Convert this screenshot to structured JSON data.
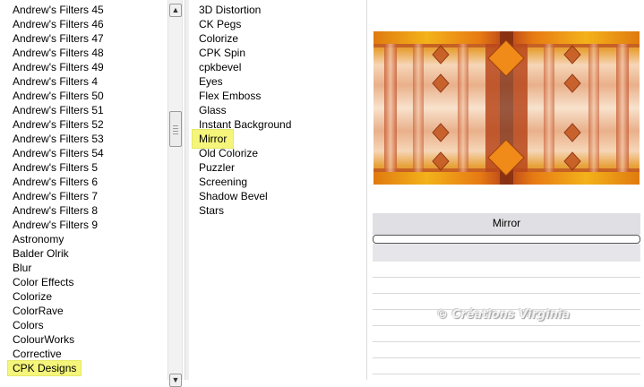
{
  "categories": [
    {
      "label": "Andrew's Filters 45"
    },
    {
      "label": "Andrew's Filters 46"
    },
    {
      "label": "Andrew's Filters 47"
    },
    {
      "label": "Andrew's Filters 48"
    },
    {
      "label": "Andrew's Filters 49"
    },
    {
      "label": "Andrew's Filters 4"
    },
    {
      "label": "Andrew's Filters 50"
    },
    {
      "label": "Andrew's Filters 51"
    },
    {
      "label": "Andrew's Filters 52"
    },
    {
      "label": "Andrew's Filters 53"
    },
    {
      "label": "Andrew's Filters 54"
    },
    {
      "label": "Andrew's Filters 5"
    },
    {
      "label": "Andrew's Filters 6"
    },
    {
      "label": "Andrew's Filters 7"
    },
    {
      "label": "Andrew's Filters 8"
    },
    {
      "label": "Andrew's Filters 9"
    },
    {
      "label": "Astronomy"
    },
    {
      "label": "Balder Olrik"
    },
    {
      "label": "Blur"
    },
    {
      "label": "Color Effects"
    },
    {
      "label": "Colorize"
    },
    {
      "label": "ColorRave"
    },
    {
      "label": "Colors"
    },
    {
      "label": "ColourWorks"
    },
    {
      "label": "Corrective"
    },
    {
      "label": "CPK Designs"
    }
  ],
  "selected_category": "CPK Designs",
  "filters": [
    {
      "label": "3D Distortion"
    },
    {
      "label": "CK Pegs"
    },
    {
      "label": "Colorize"
    },
    {
      "label": "CPK Spin"
    },
    {
      "label": "cpkbevel"
    },
    {
      "label": "Eyes"
    },
    {
      "label": "Flex Emboss"
    },
    {
      "label": "Glass"
    },
    {
      "label": "Instant Background"
    },
    {
      "label": "Mirror"
    },
    {
      "label": "Old Colorize"
    },
    {
      "label": "Puzzler"
    },
    {
      "label": "Screening"
    },
    {
      "label": "Shadow Bevel"
    },
    {
      "label": "Stars"
    }
  ],
  "selected_filter": "Mirror",
  "param": {
    "label": "Mirror"
  },
  "watermark": "© Créations Virginia",
  "icons": {
    "scroll_up": "scroll-up-arrow-icon",
    "scroll_down": "scroll-down-arrow-icon"
  },
  "colors": {
    "highlight": "#f4f57a"
  }
}
